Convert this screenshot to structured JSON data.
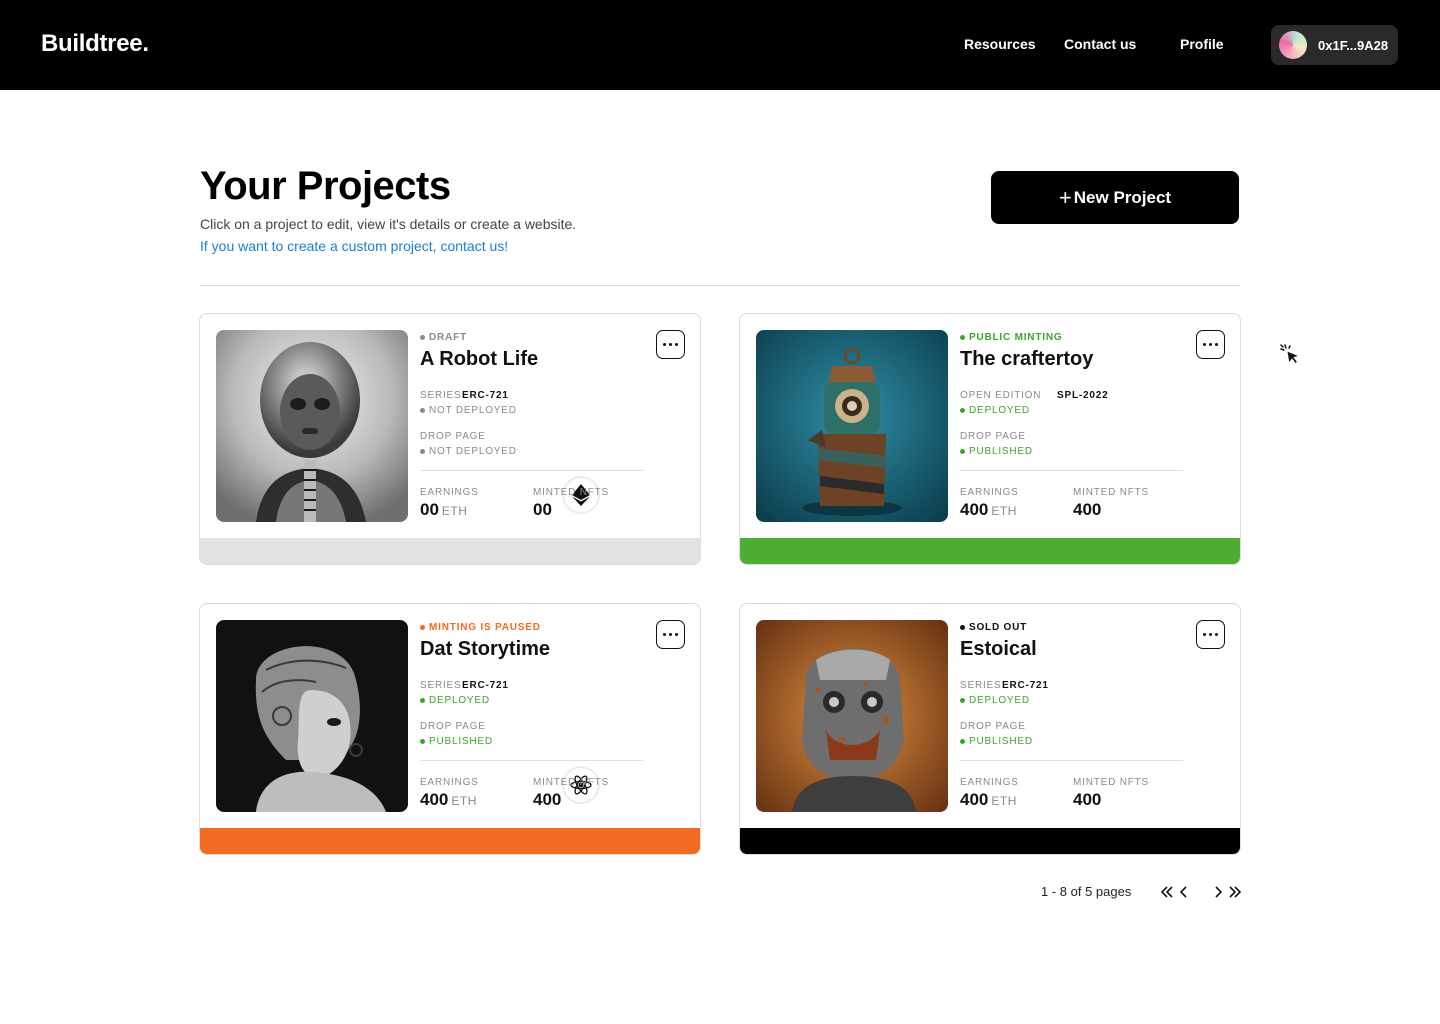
{
  "header": {
    "logo": "Buildtree.",
    "nav": [
      "Resources",
      "Contact us",
      "Profile"
    ],
    "wallet": "0x1F...9A28"
  },
  "page": {
    "title": "Your Projects",
    "subtitle": "Click on a project to edit, view it's details or create a website.",
    "contact_link": "If you want to create a custom project, contact us!",
    "new_project": "New Project"
  },
  "projects": [
    {
      "status": "DRAFT",
      "status_color": "#8a8a8a",
      "title": "A Robot Life",
      "contract_label": "SERIES",
      "contract_value": "ERC-721",
      "contract_state": "NOT DEPLOYED",
      "contract_state_color": "#8a8a8a",
      "drop_label": "DROP PAGE",
      "drop_state": "NOT DEPLOYED",
      "drop_state_color": "#8a8a8a",
      "earnings_label": "EARNINGS",
      "earnings": "00",
      "earnings_unit": "ETH",
      "minted_label": "MINTED NFTS",
      "minted": "00",
      "bar_color": "#e2e2e2",
      "chain_icon": "ethereum-icon"
    },
    {
      "status": "PUBLIC MINTING",
      "status_color": "#3aa72a",
      "title": "The craftertoy",
      "contract_label": "OPEN EDITION",
      "contract_value": "SPL-2022",
      "contract_state": "DEPLOYED",
      "contract_state_color": "#3aa72a",
      "drop_label": "DROP PAGE",
      "drop_state": "PUBLISHED",
      "drop_state_color": "#3aa72a",
      "earnings_label": "EARNINGS",
      "earnings": "400",
      "earnings_unit": "ETH",
      "minted_label": "MINTED NFTS",
      "minted": "400",
      "bar_color": "#4caf34",
      "chain_icon": "solana-icon"
    },
    {
      "status": "MINTING IS PAUSED",
      "status_color": "#f26b21",
      "title": "Dat Storytime",
      "contract_label": "SERIES",
      "contract_value": "ERC-721",
      "contract_state": "DEPLOYED",
      "contract_state_color": "#3aa72a",
      "drop_label": "DROP PAGE",
      "drop_state": "PUBLISHED",
      "drop_state_color": "#3aa72a",
      "earnings_label": "EARNINGS",
      "earnings": "400",
      "earnings_unit": "ETH",
      "minted_label": "MINTED NFTS",
      "minted": "400",
      "bar_color": "#f26b21",
      "chain_icon": "cosmos-icon"
    },
    {
      "status": "SOLD OUT",
      "status_color": "#111111",
      "title": "Estoical",
      "contract_label": "SERIES",
      "contract_value": "ERC-721",
      "contract_state": "DEPLOYED",
      "contract_state_color": "#3aa72a",
      "drop_label": "DROP PAGE",
      "drop_state": "PUBLISHED",
      "drop_state_color": "#3aa72a",
      "earnings_label": "EARNINGS",
      "earnings": "400",
      "earnings_unit": "ETH",
      "minted_label": "MINTED NFTS",
      "minted": "400",
      "bar_color": "#000000",
      "chain_icon": "polygon-icon"
    }
  ],
  "pagination": {
    "text": "1 - 8 of 5 pages"
  }
}
